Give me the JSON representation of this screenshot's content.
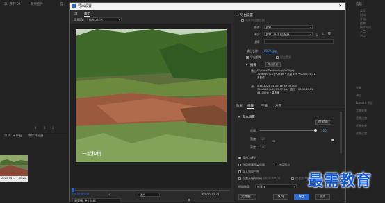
{
  "background_panels": {
    "left_top_label": "源: 序列 02",
    "left_tab2": "效果控件",
    "left_tab3": "音",
    "right_header": "信息",
    "right_lines": [
      "类型",
      "时间",
      "开始",
      "结束",
      "持续时间",
      "入点",
      "出点"
    ],
    "right_list": [
      "效果",
      "预设",
      "Lumetri 预设",
      "音频效果",
      "音频过渡",
      "视频效果",
      "视频过渡"
    ],
    "proj_label": "项目: 未命名",
    "media_browser": "媒体浏览器",
    "clip_name": "2023_04_...",
    "clip_duration": "20:21",
    "left_numbers": [
      "8",
      "1",
      "2"
    ]
  },
  "dialog": {
    "title": "导出设置",
    "close_glyph": "✕",
    "tabs": [
      "源",
      "输出"
    ],
    "scale_label": "源缩放:",
    "scale_value": "缩放以适合",
    "watermark": "一起种树",
    "timecode_start": "00;00;00;00",
    "timecode_end": "00;00;20;21",
    "fit_label": "适合",
    "source_range_value": "源范围: 整个剪辑"
  },
  "export_settings": {
    "section_title": "导出设置",
    "match_sequence_label": "与序列设置匹配",
    "format_label": "格式:",
    "format_value": "JPEG",
    "preset_label": "预设:",
    "preset_value": "JPEG 序列 (匹配源)",
    "comments_label": "注释:",
    "comments_value": "",
    "output_name_label": "输出名称:",
    "output_name_value": "0000.jpg",
    "export_video_label": "导出视频",
    "export_audio_label": "导出音频",
    "summary_title": "摘要",
    "summary_button": "导出预设",
    "output_label": "输出:",
    "output_lines": [
      "C:\\Users\\Desktop\\jpg\\0000.jpg",
      "720x540 (1.0) • 25fps • 质量 100 • 00;00;20;21",
      "无音频"
    ],
    "source_label": "源:",
    "source_lines": [
      "剪辑: 2023_04_03_18_49_39.mp4",
      "720x540 (1.0), 29.97 fps • 逐行 • 00;00;20;21",
      "44100 Hz • 单声道"
    ]
  },
  "bottom_tabs": [
    "效果",
    "视频",
    "字幕",
    "发布"
  ],
  "video_section": {
    "title": "基本设置",
    "match_source_button": "匹配源",
    "quality_label": "质量:",
    "quality_value": "100",
    "quality_fraction": 0.98,
    "width_label": "宽度:",
    "width_value": "720",
    "height_label": "高度:",
    "height_value": "540"
  },
  "options": {
    "export_as_sequence": "导出为序列",
    "use_max_render": "使用最高渲染质量",
    "use_previews": "使用预览",
    "import_into_project": "导入到项目中",
    "set_start_timecode": "设置开始时间码",
    "set_start_timecode_value": "00;00;00;00",
    "render_alpha_only": "仅渲染 Alpha 通道",
    "time_interp_label": "时间插值:",
    "time_interp_value": "帧采样"
  },
  "buttons": {
    "metadata": "元数据...",
    "queue": "队列",
    "export": "导出",
    "cancel": "取消"
  },
  "overlay_text": "最需教育",
  "colors": {
    "accent": "#2a6bd3",
    "link": "#5aa0ff",
    "overlay": "#1459d0"
  }
}
